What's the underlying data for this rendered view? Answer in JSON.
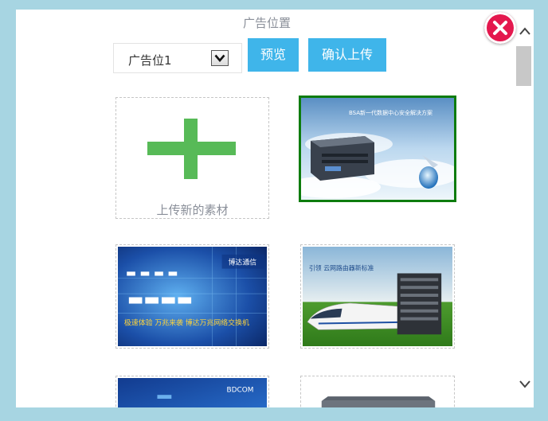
{
  "dialog": {
    "title": "广告位置",
    "close_icon": "close-icon",
    "position_select": {
      "value": "广告位1",
      "icon": "chevron-down-icon"
    },
    "preview_label": "预览",
    "confirm_upload_label": "确认上传"
  },
  "materials": {
    "upload_new_label": "上传新的素材",
    "upload_icon": "plus-icon",
    "items": [
      {
        "name": "bsa-server-ad",
        "selected": true,
        "caption": "BSA新一代数据中心安全解决方案"
      },
      {
        "name": "10g-switch-ad",
        "selected": false,
        "caption": "极速体验 万兆来袭 博达万兆网络交换机",
        "brand": "博达通信"
      },
      {
        "name": "train-router-ad",
        "selected": false,
        "caption": "引领 云网路由器新标准"
      },
      {
        "name": "bdcom-ad",
        "selected": false,
        "brand": "BDCOM"
      },
      {
        "name": "device-ad",
        "selected": false
      }
    ]
  },
  "colors": {
    "accent_button": "#3fb5ea",
    "selected_border": "#0e7c0e",
    "plus_green": "#57ba57",
    "close_red": "#e4184e",
    "page_background": "#a7d5e2"
  }
}
